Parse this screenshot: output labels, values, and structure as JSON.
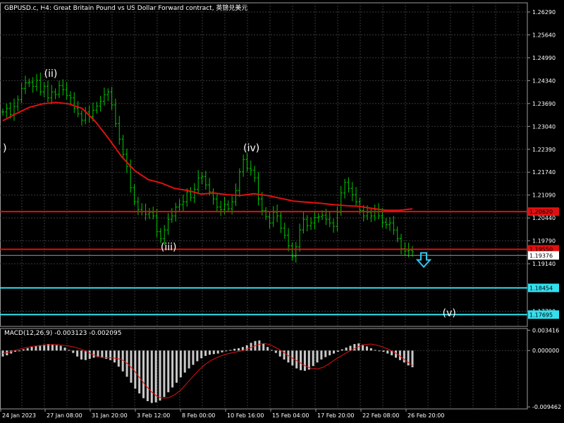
{
  "header": {
    "title": "GBPUSD.c, H4:  Great Britain Pound vs US Dollar Forward contract, 英镑兑美元"
  },
  "macd_header": {
    "label": "MACD(12,26,9) -0.003123 -0.002095"
  },
  "colors": {
    "background": "#000000",
    "grid": "#3a3a3a",
    "candles": "#00c800",
    "moving_average": "#e01010",
    "resistance_line": "#e01010",
    "target_line": "#33e0f0",
    "price_line": "#9a9a9a",
    "macd_histogram": "#c8c8c8",
    "macd_signal": "#e01010",
    "arrow": "#33c8ee",
    "text": "#ffffff"
  },
  "chart_data": [
    {
      "type": "line",
      "symbol": "GBPUSD.c",
      "timeframe": "H4",
      "price_axis_ticks": [
        "1.26290",
        "1.25640",
        "1.24990",
        "1.24340",
        "1.23690",
        "1.23040",
        "1.22390",
        "1.21740",
        "1.21090",
        "1.20440",
        "1.19790",
        "1.19140",
        "1.17790"
      ],
      "time_axis_ticks": [
        "24 Jan 2023",
        "27 Jan 08:00",
        "31 Jan 20:00",
        "3 Feb 12:00",
        "8 Feb 00:00",
        "10 Feb 16:00",
        "15 Feb 04:00",
        "17 Feb 20:00",
        "22 Feb 08:00",
        "26 Feb 20:00"
      ],
      "ylim": [
        1.1736,
        1.2655
      ],
      "grid": true,
      "close_series": [
        1.2345,
        1.2355,
        1.2338,
        1.2361,
        1.238,
        1.2412,
        1.2428,
        1.243,
        1.2418,
        1.2435,
        1.2402,
        1.2418,
        1.2385,
        1.2402,
        1.2395,
        1.242,
        1.2408,
        1.2392,
        1.2385,
        1.2356,
        1.234,
        1.2322,
        1.2345,
        1.2332,
        1.235,
        1.2362,
        1.2375,
        1.2394,
        1.2402,
        1.2365,
        1.2312,
        1.2268,
        1.2225,
        1.219,
        1.213,
        1.209,
        1.2068,
        1.2063,
        1.2055,
        1.206,
        1.205,
        1.2005,
        1.1985,
        1.201,
        1.204,
        1.205,
        1.2075,
        1.2082,
        1.209,
        1.2118,
        1.2102,
        1.2125,
        1.2158,
        1.2162,
        1.2138,
        1.2118,
        1.2098,
        1.2075,
        1.2068,
        1.2082,
        1.207,
        1.209,
        1.2122,
        1.2175,
        1.221,
        1.2185,
        1.218,
        1.2158,
        1.2098,
        1.2065,
        1.2048,
        1.203,
        1.206,
        1.205,
        1.2015,
        1.1995,
        1.1965,
        1.1935,
        1.1962,
        1.201,
        1.204,
        1.2022,
        1.203,
        1.2045,
        1.2048,
        1.2052,
        1.204,
        1.203,
        1.202,
        1.206,
        1.2115,
        1.2145,
        1.2128,
        1.211,
        1.209,
        1.2065,
        1.205,
        1.206,
        1.205,
        1.2068,
        1.205,
        1.2032,
        1.2025,
        1.203,
        1.201,
        1.1985,
        1.1957,
        1.195,
        1.1952,
        1.1948
      ],
      "moving_average": [
        1.232,
        1.234,
        1.2358,
        1.2368,
        1.2372,
        1.2368,
        1.2355,
        1.2318,
        1.227,
        1.2218,
        1.2178,
        1.2153,
        1.2143,
        1.2128,
        1.2122,
        1.2112,
        1.2115,
        1.211,
        1.2108,
        1.2113,
        1.2108,
        1.21,
        1.2092,
        1.2089,
        1.2086,
        1.2082,
        1.2079,
        1.2077,
        1.2071,
        1.2066,
        1.2066,
        1.207
      ],
      "horizontal_lines": [
        {
          "price": 1.2062,
          "label": "1.20620"
        },
        {
          "price": 1.1955,
          "label": "1.19550"
        },
        {
          "price": 1.19376,
          "label": "1.19376"
        },
        {
          "price": 1.18454,
          "label": "1.18454"
        },
        {
          "price": 1.17695,
          "label": "1.17695"
        }
      ],
      "wave_labels": [
        {
          "text": "(ii)",
          "x": 11,
          "price": 1.2445
        },
        {
          "text": "(iii)",
          "x": 42,
          "price": 1.1952
        },
        {
          "text": "(iv)",
          "x": 64,
          "price": 1.2234
        },
        {
          "text": "(v)",
          "x": 117,
          "price": 1.1765
        },
        {
          "text": ")",
          "x": 0,
          "price": 1.2234
        }
      ]
    },
    {
      "type": "bar",
      "title": "MACD(12,26,9) -0.003123 -0.002095",
      "axis_ticks": [
        "0.003416",
        "0.000000",
        "-0.009462"
      ],
      "ylim": [
        -0.0098,
        0.0037
      ],
      "values": [
        -0.001,
        -0.0008,
        -0.0005,
        -0.0002,
        0.0,
        0.0002,
        0.0004,
        0.0006,
        0.0008,
        0.0009,
        0.001,
        0.0011,
        0.001,
        0.0009,
        0.0008,
        0.0005,
        0.0001,
        -0.0004,
        -0.001,
        -0.0015,
        -0.0016,
        -0.0014,
        -0.0012,
        -0.0011,
        -0.0012,
        -0.0014,
        -0.0016,
        -0.002,
        -0.0027,
        -0.0035,
        -0.0044,
        -0.0054,
        -0.0064,
        -0.0072,
        -0.008,
        -0.0085,
        -0.0088,
        -0.0087,
        -0.0084,
        -0.0078,
        -0.007,
        -0.0062,
        -0.0054,
        -0.0045,
        -0.0037,
        -0.003,
        -0.0024,
        -0.0018,
        -0.0013,
        -0.0009,
        -0.0007,
        -0.0006,
        -0.0005,
        -0.0003,
        -0.0001,
        0.0001,
        0.0003,
        0.0004,
        0.0006,
        0.0009,
        0.0013,
        0.0016,
        0.0017,
        0.0012,
        0.0006,
        0.0001,
        -0.0004,
        -0.001,
        -0.0015,
        -0.002,
        -0.0025,
        -0.003,
        -0.0033,
        -0.0034,
        -0.0032,
        -0.0026,
        -0.002,
        -0.0015,
        -0.0011,
        -0.0008,
        -0.0005,
        -0.0002,
        0.0002,
        0.0005,
        0.0008,
        0.0011,
        0.0012,
        0.001,
        0.0007,
        0.0004,
        0.0001,
        -0.0001,
        -0.0002,
        -0.0005,
        -0.0008,
        -0.0012,
        -0.0016,
        -0.002,
        -0.0025,
        -0.0028
      ],
      "signal": [
        -0.0005,
        -0.0003,
        0.0,
        0.0003,
        0.0005,
        0.0007,
        0.0008,
        0.0009,
        0.001,
        0.001,
        0.0009,
        0.0008,
        0.0006,
        0.0003,
        -0.0001,
        -0.0006,
        -0.001,
        -0.0012,
        -0.0012,
        -0.0013,
        -0.0015,
        -0.0022,
        -0.0032,
        -0.0045,
        -0.0058,
        -0.0069,
        -0.0077,
        -0.008,
        -0.0079,
        -0.0074,
        -0.0066,
        -0.0055,
        -0.0044,
        -0.0033,
        -0.0024,
        -0.0017,
        -0.0012,
        -0.0008,
        -0.0005,
        -0.0003,
        -0.0001,
        0.0002,
        0.0006,
        0.001,
        0.0012,
        0.001,
        0.0005,
        -0.0001,
        -0.0008,
        -0.0014,
        -0.002,
        -0.0026,
        -0.003,
        -0.0031,
        -0.0028,
        -0.0022,
        -0.0015,
        -0.0009,
        -0.0003,
        0.0002,
        0.0007,
        0.001,
        0.0011,
        0.0009,
        0.0006,
        0.0002,
        -0.0003,
        -0.001,
        -0.0018,
        -0.0025
      ]
    }
  ]
}
